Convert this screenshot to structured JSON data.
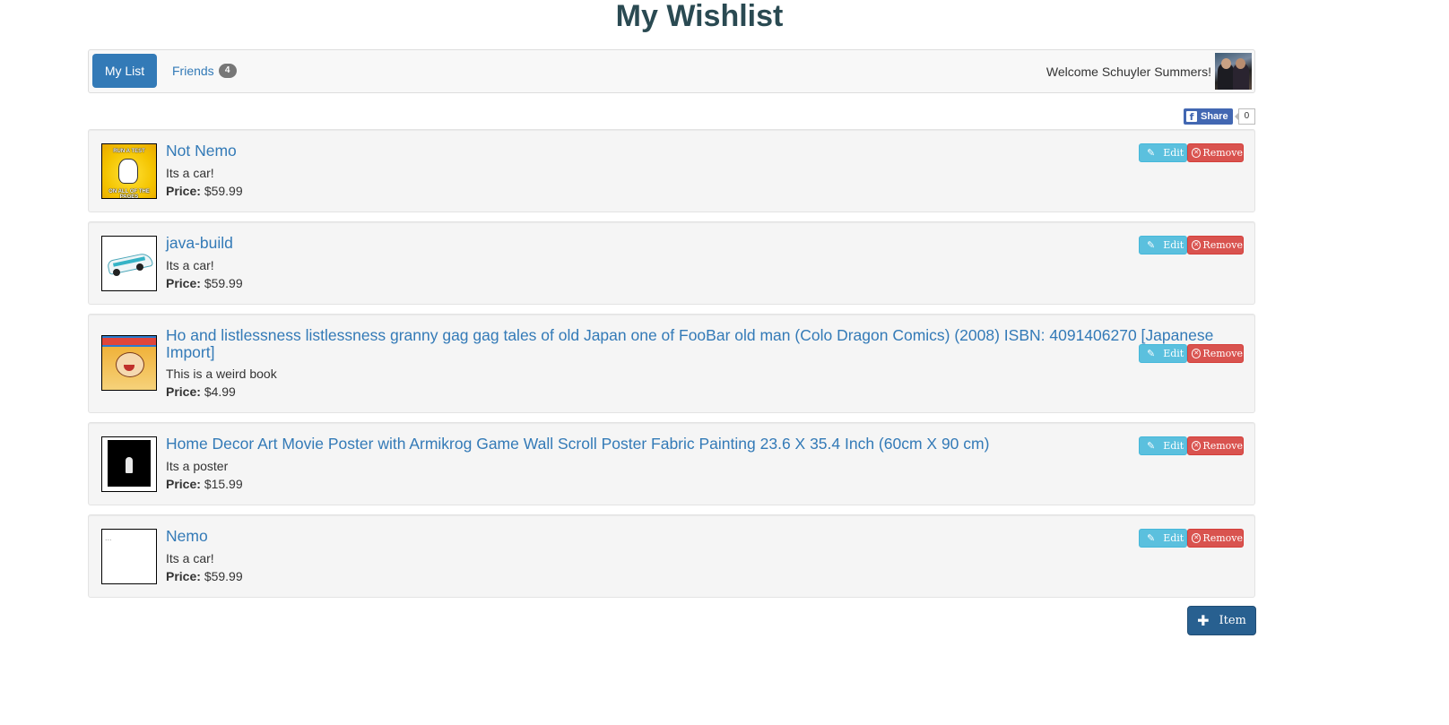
{
  "page": {
    "title": "My Wishlist"
  },
  "nav": {
    "tabs": [
      {
        "label": "My List",
        "active": true
      },
      {
        "label": "Friends",
        "badge": "4"
      }
    ],
    "welcome": "Welcome Schuyler Summers!"
  },
  "share": {
    "label": "Share",
    "count": "0",
    "fb_glyph": "f"
  },
  "items": [
    {
      "title": "Not Nemo",
      "description": "Its a car!",
      "price_label": "Price:",
      "price": "$59.99",
      "thumb": "meme-image",
      "thumb_top_text": "RUN A TEST",
      "thumb_bottom_text": "ON ALL OF THE PAGES"
    },
    {
      "title": "java-build",
      "description": "Its a car!",
      "price_label": "Price:",
      "price": "$59.99",
      "thumb": "car-image"
    },
    {
      "title": "Ho and listlessness listlessness granny gag gag tales of old Japan one of FooBar old man (Colo Dragon Comics) (2008) ISBN: 4091406270 [Japanese Import]",
      "description": "This is a weird book",
      "price_label": "Price:",
      "price": "$4.99",
      "thumb": "comic-image"
    },
    {
      "title": "Home Decor Art Movie Poster with Armikrog Game Wall Scroll Poster Fabric Painting 23.6 X 35.4 Inch (60cm X 90 cm)",
      "description": "Its a poster",
      "price_label": "Price:",
      "price": "$15.99",
      "thumb": "poster-image"
    },
    {
      "title": "Nemo",
      "description": "Its a car!",
      "price_label": "Price:",
      "price": "$59.99",
      "thumb": "blank-image",
      "thumb_placeholder": "..."
    }
  ],
  "buttons": {
    "edit": "Edit",
    "remove": "Remove",
    "add_item": "Item"
  },
  "icons": {
    "edit": "pencil-icon",
    "remove": "remove-circle-icon",
    "add": "plus-icon",
    "share": "facebook-icon"
  },
  "colors": {
    "primary": "#337ab7",
    "info": "#5bc0de",
    "danger": "#d9534f",
    "add_button": "#286090",
    "facebook": "#4267b2"
  }
}
